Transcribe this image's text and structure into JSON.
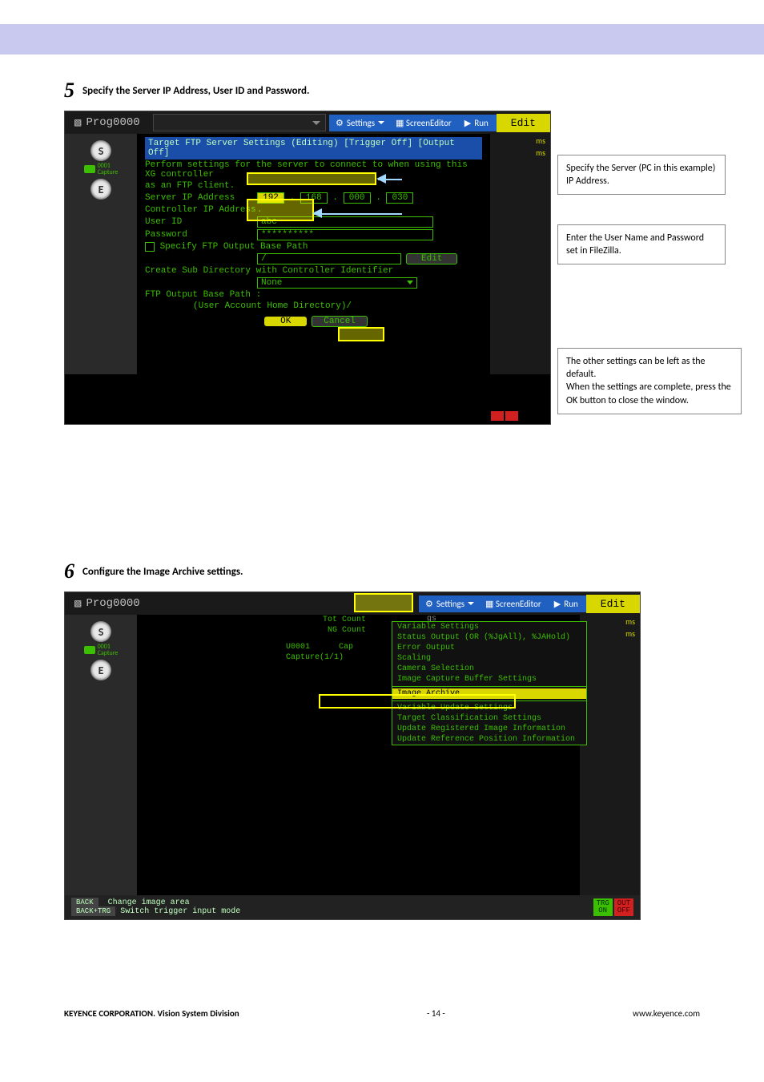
{
  "step5": {
    "number": "5",
    "text": "Specify the Server IP Address, User ID and Password."
  },
  "step6": {
    "number": "6",
    "text": "Configure the Image Archive settings."
  },
  "app": {
    "prog": "Prog0000",
    "settings": "Settings",
    "screen_editor": "ScreenEditor",
    "run": "Run",
    "edit": "Edit",
    "sidebar": {
      "s": "S",
      "e": "E",
      "cap_num": "0001",
      "cap_lbl": "Capture"
    },
    "ms1": "ms",
    "ms2": "ms"
  },
  "dlg": {
    "title": "Target FTP Server Settings (Editing)  [Trigger Off] [Output Off]",
    "desc": "Perform settings for the server to connect to when using this XG controller",
    "desc2": "as an FTP client.",
    "server_ip_lbl": "Server IP Address",
    "ip": [
      "192",
      "168",
      "000",
      "030"
    ],
    "ctrl_ip_lbl": "Controller IP Address",
    "ctrl_ip_dot": ".",
    "user_id_lbl": "User ID",
    "user_id_val": "abc",
    "pw_lbl": "Password",
    "pw_val": "**********",
    "chk_lbl": "Specify FTP Output Base Path",
    "path_val": "/",
    "edit_btn": "Edit",
    "sub_lbl": "Create Sub Directory with Controller Identifier",
    "sub_val": "None",
    "base_lbl": "FTP Output Base Path :",
    "base_val": "(User Account Home Directory)/",
    "ok": "OK",
    "cancel": "Cancel"
  },
  "callouts": {
    "c1": "Specify the Server (PC in this example) IP Address.",
    "c2": "Enter the User Name and Password set in FileZilla.",
    "c3": "The other settings can be left as the default.\nWhen the settings are complete, press the OK button to close the window."
  },
  "ss2": {
    "info": {
      "tot": "Tot Count",
      "ng": "NG Count",
      "u": "U0001",
      "cap_pre": "Cap",
      "cap": "Capture(1/1)"
    },
    "gs": "gs",
    "menu": {
      "items_a": [
        "Variable Settings",
        "Status Output (OR (%JgAll), %JAHold)",
        "Error Output",
        "Scaling",
        "Camera Selection",
        "Image Capture Buffer Settings"
      ],
      "hl": "Image Archive",
      "items_b": [
        "Variable Update Settings",
        "Target Classification Settings",
        "Update Registered Image Information",
        "Update Reference Position Information"
      ]
    },
    "footer": {
      "back": "BACK",
      "back_txt": "Change image area",
      "back_trg": "BACK+TRG",
      "back_trg_txt": "Switch trigger input mode",
      "trg_on": "TRG\nON",
      "trg_off": "OUT\nOFF"
    }
  },
  "footer": {
    "left": "KEYENCE CORPORATION. Vision System Division",
    "mid": "- 14 -",
    "right": "www.keyence.com"
  }
}
